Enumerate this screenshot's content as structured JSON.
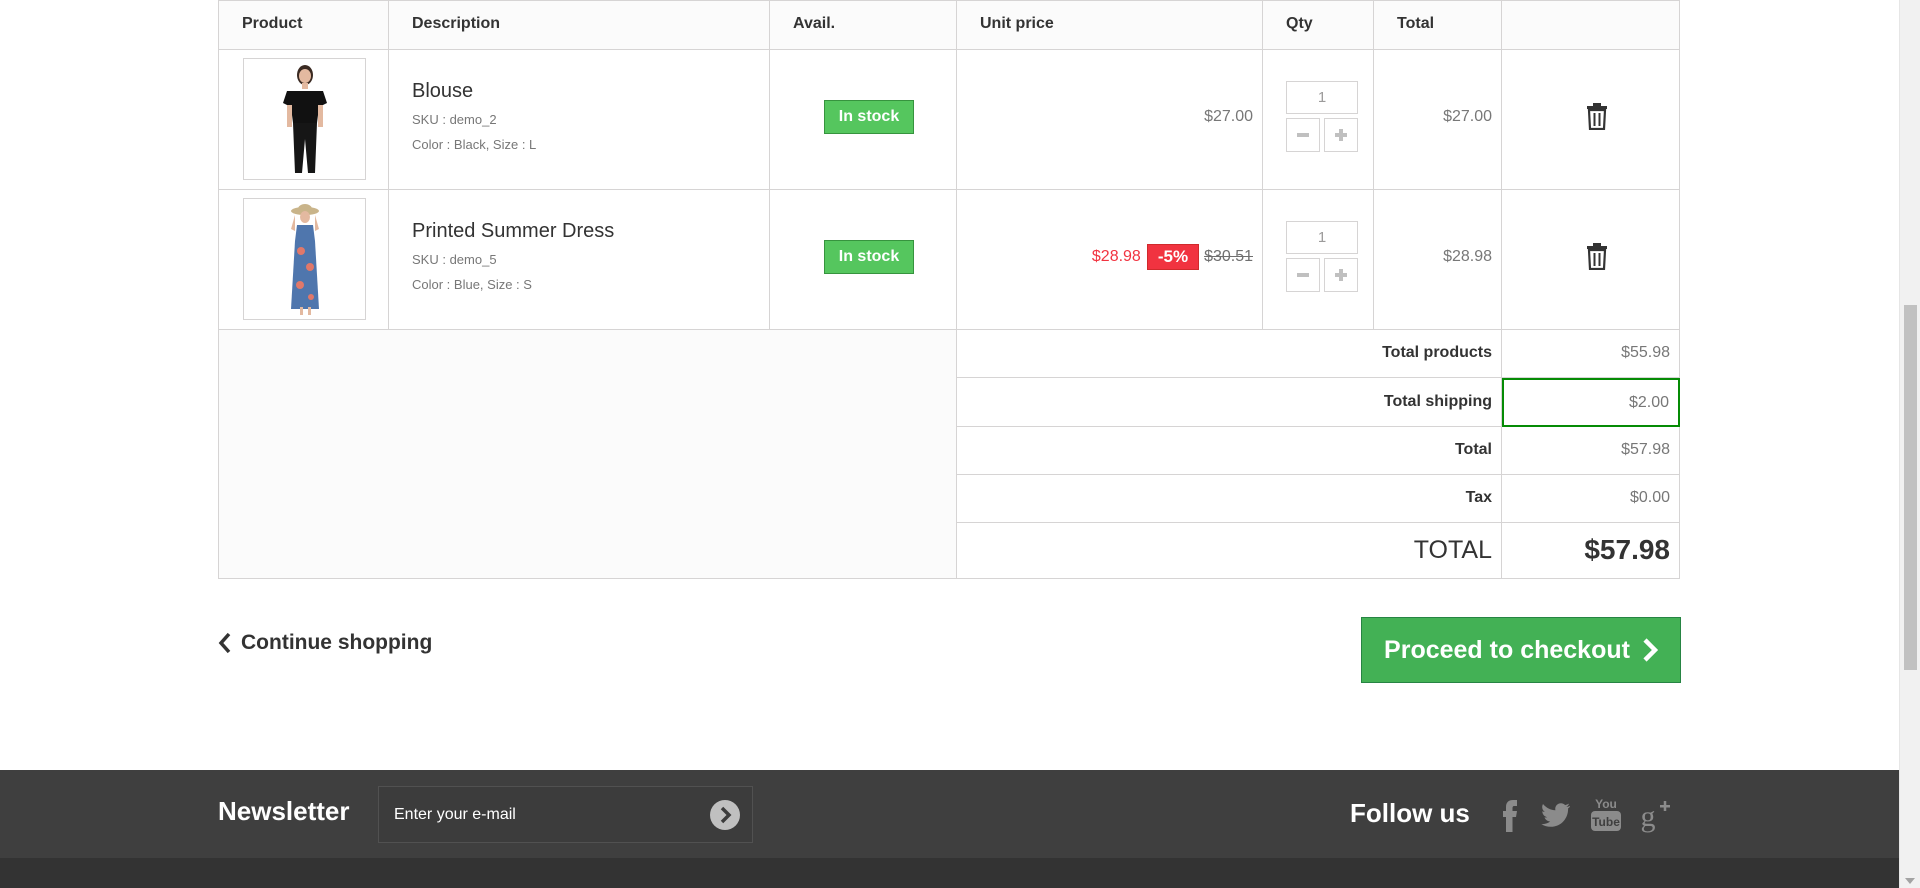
{
  "table": {
    "headers": [
      "Product",
      "Description",
      "Avail.",
      "Unit price",
      "Qty",
      "Total",
      ""
    ],
    "items": [
      {
        "name": "Blouse",
        "sku": "SKU : demo_2",
        "attributes": "Color : Black, Size : L",
        "availability": "In stock",
        "unit_price": "$27.00",
        "qty": "1",
        "total": "$27.00"
      },
      {
        "name": "Printed Summer Dress",
        "sku": "SKU : demo_5",
        "attributes": "Color : Blue, Size : S",
        "availability": "In stock",
        "unit_price": "$28.98",
        "discount": "-5%",
        "old_price": "$30.51",
        "qty": "1",
        "total": "$28.98"
      }
    ]
  },
  "totals": [
    {
      "label": "Total products",
      "value": "$55.98"
    },
    {
      "label": "Total shipping",
      "value": "$2.00"
    },
    {
      "label": "Total",
      "value": "$57.98"
    },
    {
      "label": "Tax",
      "value": "$0.00"
    },
    {
      "label": "TOTAL",
      "value": "$57.98"
    }
  ],
  "actions": {
    "continue_label": "Continue shopping",
    "checkout_label": "Proceed to checkout"
  },
  "footer": {
    "newsletter_title": "Newsletter",
    "newsletter_placeholder": "Enter your e-mail",
    "follow_title": "Follow us",
    "social": [
      "facebook-icon",
      "twitter-icon",
      "youtube-icon",
      "google-plus-icon"
    ]
  },
  "colors": {
    "in_stock": "#55c65e",
    "checkout": "#43b155",
    "discount": "#f13340",
    "footer_bg": "#3f3f3f",
    "shipping_highlight": "#058b05"
  }
}
